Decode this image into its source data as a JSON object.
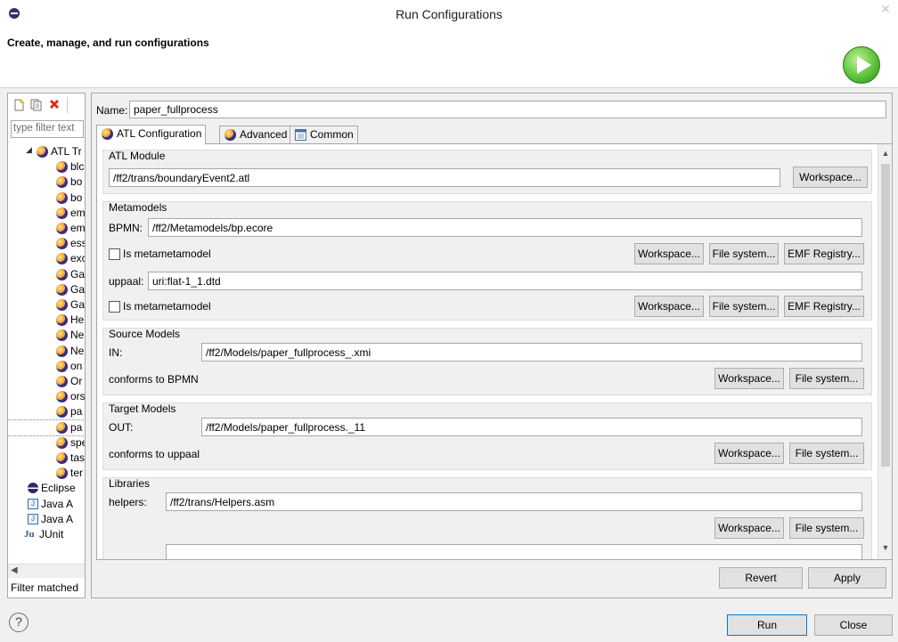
{
  "window": {
    "title": "Run Configurations"
  },
  "header": {
    "title": "Create, manage, and run configurations"
  },
  "left": {
    "filter_placeholder": "type filter text",
    "tree": [
      {
        "label": "ATL Tr",
        "indent": 0,
        "kind": "category",
        "expanded": true
      },
      {
        "label": "blc",
        "indent": 1,
        "kind": "atl"
      },
      {
        "label": "bo",
        "indent": 1,
        "kind": "atl"
      },
      {
        "label": "bo",
        "indent": 1,
        "kind": "atl"
      },
      {
        "label": "em",
        "indent": 1,
        "kind": "atl"
      },
      {
        "label": "em",
        "indent": 1,
        "kind": "atl"
      },
      {
        "label": "ess",
        "indent": 1,
        "kind": "atl"
      },
      {
        "label": "exc",
        "indent": 1,
        "kind": "atl"
      },
      {
        "label": "Ga",
        "indent": 1,
        "kind": "atl"
      },
      {
        "label": "Ga",
        "indent": 1,
        "kind": "atl"
      },
      {
        "label": "Ga",
        "indent": 1,
        "kind": "atl"
      },
      {
        "label": "He",
        "indent": 1,
        "kind": "atl"
      },
      {
        "label": "Ne",
        "indent": 1,
        "kind": "atl"
      },
      {
        "label": "Ne",
        "indent": 1,
        "kind": "atl"
      },
      {
        "label": "on",
        "indent": 1,
        "kind": "atl"
      },
      {
        "label": "Or",
        "indent": 1,
        "kind": "atl"
      },
      {
        "label": "ors",
        "indent": 1,
        "kind": "atl"
      },
      {
        "label": "pa",
        "indent": 1,
        "kind": "atl"
      },
      {
        "label": "pa",
        "indent": 1,
        "kind": "atl",
        "selected": true
      },
      {
        "label": "spe",
        "indent": 1,
        "kind": "atl"
      },
      {
        "label": "tas",
        "indent": 1,
        "kind": "atl"
      },
      {
        "label": "ter",
        "indent": 1,
        "kind": "atl"
      },
      {
        "label": "Eclipse",
        "indent": 0,
        "kind": "eclipse"
      },
      {
        "label": "Java A",
        "indent": 0,
        "kind": "java-applet"
      },
      {
        "label": "Java A",
        "indent": 0,
        "kind": "java-app"
      },
      {
        "label": "JUnit",
        "indent": 0,
        "kind": "junit"
      }
    ],
    "filter_status": "Filter matched"
  },
  "config": {
    "name_label": "Name:",
    "name_value": "paper_fullprocess",
    "tabs": [
      {
        "label": "ATL Configuration",
        "active": true
      },
      {
        "label": "Advanced",
        "active": false
      },
      {
        "label": "Common",
        "active": false
      }
    ],
    "atl_module": {
      "title": "ATL Module",
      "path": "/ff2/trans/boundaryEvent2.atl",
      "workspace_btn": "Workspace..."
    },
    "metamodels": {
      "title": "Metamodels",
      "bpmn_label": "BPMN:",
      "bpmn_value": "/ff2/Metamodels/bp.ecore",
      "is_metametamodel_label": "Is metametamodel",
      "uppaal_label": "uppaal:",
      "uppaal_value": "uri:flat-1_1.dtd",
      "workspace_btn": "Workspace...",
      "filesystem_btn": "File system...",
      "emf_btn": "EMF Registry..."
    },
    "source_models": {
      "title": "Source Models",
      "in_label": "IN:",
      "in_value": "/ff2/Models/paper_fullprocess_.xmi",
      "conforms_label": "conforms to BPMN",
      "workspace_btn": "Workspace...",
      "filesystem_btn": "File system..."
    },
    "target_models": {
      "title": "Target Models",
      "out_label": "OUT:",
      "out_value": "/ff2/Models/paper_fullprocess._11",
      "conforms_label": "conforms to uppaal",
      "workspace_btn": "Workspace...",
      "filesystem_btn": "File system..."
    },
    "libraries": {
      "title": "Libraries",
      "helpers_label": "helpers:",
      "helpers_value": "/ff2/trans/Helpers.asm",
      "workspace_btn": "Workspace...",
      "filesystem_btn": "File system..."
    },
    "revert_btn": "Revert",
    "apply_btn": "Apply"
  },
  "footer": {
    "help_symbol": "?",
    "run_btn": "Run",
    "close_btn": "Close"
  }
}
